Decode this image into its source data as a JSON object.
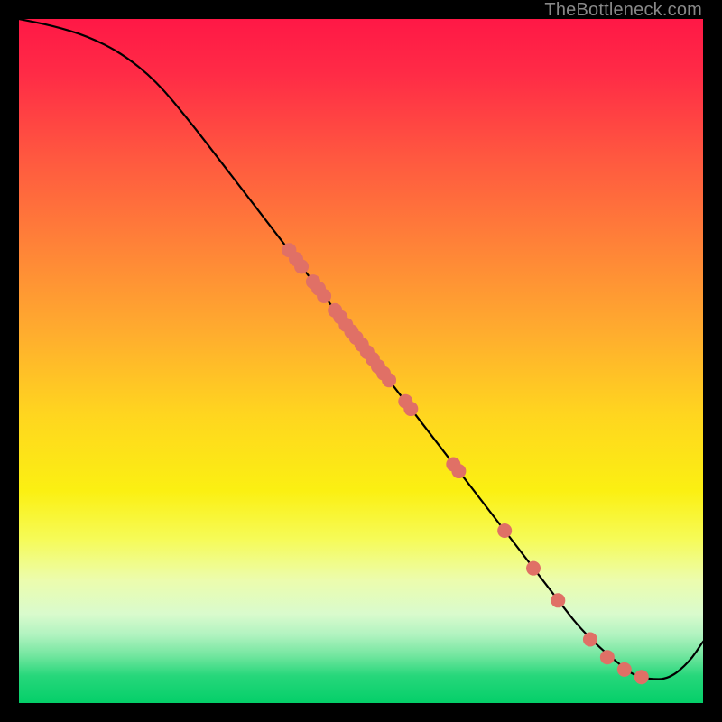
{
  "watermark": "TheBottleneck.com",
  "colors": {
    "curve": "#000000",
    "points_fill": "#e07066",
    "points_stroke": "#c55b52",
    "background_top": "#ff1846",
    "background_bottom": "#04cf69",
    "frame": "#000000"
  },
  "chart_data": {
    "type": "line",
    "title": "",
    "xlabel": "",
    "ylabel": "",
    "xlim": [
      0,
      100
    ],
    "ylim": [
      0,
      100
    ],
    "grid": false,
    "legend": false,
    "series": [
      {
        "name": "bottleneck-curve",
        "x": [
          0,
          5,
          10,
          15,
          20,
          25,
          30,
          35,
          40,
          45,
          50,
          55,
          60,
          65,
          70,
          75,
          80,
          82,
          85,
          88,
          90,
          92,
          95,
          98,
          100
        ],
        "y": [
          100,
          99,
          97.5,
          95,
          91,
          85,
          78.5,
          72,
          65.5,
          59,
          52.5,
          46,
          39.5,
          33,
          26.5,
          20,
          13.5,
          11,
          8,
          5.5,
          4,
          3.5,
          3.5,
          6,
          9
        ]
      }
    ],
    "points": [
      {
        "x": 39.5,
        "y": 66.2
      },
      {
        "x": 40.5,
        "y": 64.9
      },
      {
        "x": 41.3,
        "y": 63.8
      },
      {
        "x": 43.0,
        "y": 61.6
      },
      {
        "x": 43.8,
        "y": 60.6
      },
      {
        "x": 44.6,
        "y": 59.5
      },
      {
        "x": 46.2,
        "y": 57.4
      },
      {
        "x": 47.0,
        "y": 56.4
      },
      {
        "x": 47.8,
        "y": 55.3
      },
      {
        "x": 48.6,
        "y": 54.3
      },
      {
        "x": 49.3,
        "y": 53.4
      },
      {
        "x": 50.1,
        "y": 52.4
      },
      {
        "x": 50.9,
        "y": 51.3
      },
      {
        "x": 51.7,
        "y": 50.3
      },
      {
        "x": 52.5,
        "y": 49.2
      },
      {
        "x": 53.3,
        "y": 48.2
      },
      {
        "x": 54.1,
        "y": 47.2
      },
      {
        "x": 56.5,
        "y": 44.1
      },
      {
        "x": 57.3,
        "y": 43.0
      },
      {
        "x": 63.5,
        "y": 34.9
      },
      {
        "x": 64.3,
        "y": 33.9
      },
      {
        "x": 71.0,
        "y": 25.2
      },
      {
        "x": 75.2,
        "y": 19.7
      },
      {
        "x": 78.8,
        "y": 15.0
      },
      {
        "x": 83.5,
        "y": 9.3
      },
      {
        "x": 86.0,
        "y": 6.7
      },
      {
        "x": 88.5,
        "y": 4.9
      },
      {
        "x": 91.0,
        "y": 3.8
      }
    ]
  }
}
